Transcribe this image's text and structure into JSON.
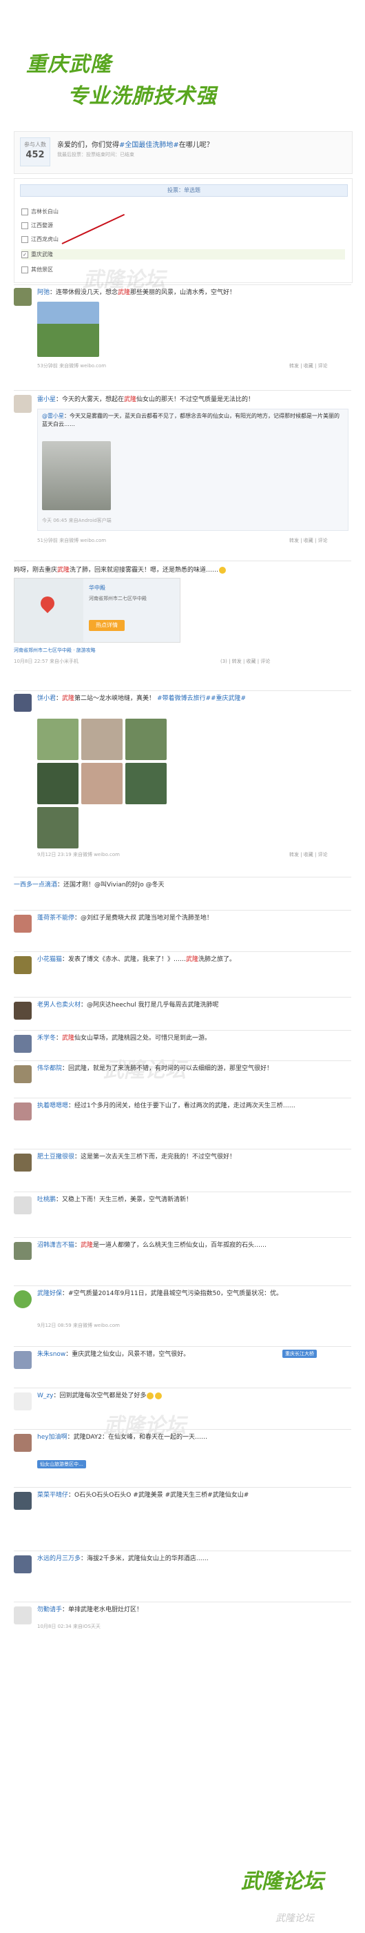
{
  "header": {
    "line1": "重庆武隆",
    "line2": "专业洗肺技术强"
  },
  "poll": {
    "count_label": "参与人数",
    "count": "452",
    "question_prefix": "亲爱的们，你们觉得",
    "question_link": "#全国最佳洗肺地#",
    "question_suffix": "在哪儿呢？",
    "meta": "我最后投票：投票结束时间：已结束",
    "bar_text": "投票：单选题",
    "options": [
      "吉林长白山",
      "江西婺源",
      "江西龙虎山",
      "重庆武隆",
      "其他景区"
    ],
    "selected_index": 3
  },
  "posts": [
    {
      "name": "阿弛",
      "text_a": "：连带休假没几天，想念",
      "kw1": "武隆",
      "text_b": "那些美丽的风景，山清水秀，空气好！",
      "meta": "53分钟前  来自微博 weibo.com",
      "acts": "转发 | 收藏 | 评论"
    },
    {
      "name": "雷小星",
      "text_a": "：今天的大雾天，想起在",
      "kw1": "武隆",
      "text_b": "仙女山的那天！不过空气质量是无法比的！",
      "quote_name": "@雷小星",
      "quote_text": "：今天又是雾霾的一天，蓝天白云都看不见了，都想念去年的仙女山，有阳光的地方，记得那时候都是一片美丽的蓝天白云……",
      "quote_meta": "今天 06:45  来自Android客户端",
      "meta": "51分钟前  来自微博 weibo.com",
      "acts": "转发 | 收藏 | 评论"
    },
    {
      "name": "",
      "text_a": "妈呀，刚去重庆",
      "kw1": "武隆",
      "text_b": "洗了肺，回来就迎接雾霾天！嗯，还是熟悉的味道……",
      "place_title": "华中殿",
      "place_addr": "河南省郑州市二七区华中殿",
      "hot_label": "热点详情",
      "loc": "河南省郑州市二七区华中殿 · 旅游攻略",
      "meta": "10月8日 22:57  来自小米手机",
      "acts": "(3) | 转发 | 收藏 | 评论"
    },
    {
      "name": "饼小君",
      "text_a": "：",
      "kw1": "武隆",
      "text_b": "第二站～龙水峡地缝，真美！",
      "tag": "#带着微博去旅行##重庆武隆#",
      "meta": "9月12日 23:19  来自微博 weibo.com",
      "acts": "转发 | 收藏 | 评论"
    },
    {
      "name": "一西多一点滴酒",
      "text_a": "：还国才刚！",
      "kw1": "",
      "text_b": "@叫Vivian的好Jo @冬天",
      "meta": "",
      "acts": ""
    },
    {
      "name": "蓬荷茶不能停",
      "text_a": "：",
      "kw1": "",
      "text_b": "@刘红子是费晓大叔 武隆当地对是个洗肺圣地！",
      "meta": "",
      "acts": ""
    },
    {
      "name": "小花猫猫",
      "text_a": "：发表了博文《赤水、武隆，我来了！》……",
      "kw1": "武隆",
      "text_b": "洗肺之旅了。",
      "meta": "",
      "acts": ""
    },
    {
      "name": "老男人也卖火材",
      "text_a": "：",
      "kw1": "",
      "text_b": "@阿庆达heechul 我打是几乎每周去武隆洗肺呢",
      "meta": "",
      "acts": ""
    },
    {
      "name": "禾学冬",
      "text_a": "：",
      "kw1": "武隆",
      "text_b": "仙女山草场，武隆桃园之处。可惜只是到此一游。",
      "meta": "",
      "acts": ""
    },
    {
      "name": "伟华都院",
      "text_a": "：",
      "kw1": "",
      "text_b": "回武隆，就是为了来洗肺不错，有时间的可以去细细的游，那里空气很好！",
      "meta": "",
      "acts": ""
    },
    {
      "name": "执着嗯嗯嗯",
      "text_a": "：",
      "kw1": "",
      "text_b": "经过1个多月的闭关，给住于要下山了，看过两次的武隆，走过两次天生三桥……",
      "meta": "",
      "acts": ""
    },
    {
      "name": "肥土豆撒很很",
      "text_a": "：",
      "kw1": "",
      "text_b": "这是第一次去天生三桥下而，走完我的！不过空气很好！",
      "meta": "",
      "acts": ""
    },
    {
      "name": "吐桃鹏",
      "text_a": "：",
      "kw1": "",
      "text_b": "又稳上下而！天生三桥，美景，空气清新清新！",
      "meta": "",
      "acts": ""
    },
    {
      "name": "沼韩潇吉不猫",
      "text_a": "：",
      "kw1": "武隆",
      "text_b": "是一道人都懒了，么么桃天生三桥仙女山，百年孤寂的石头……",
      "meta": "",
      "acts": ""
    },
    {
      "name": "武隆好保",
      "text_a": "：",
      "kw1": "",
      "text_b": "#空气质量2014年9月11日，武隆县城空气污染指数50，空气质量状况：优。",
      "meta": "9月12日 08:59  来自微博 weibo.com",
      "acts": ""
    },
    {
      "name": "朱朱snow",
      "text_a": "：重庆武隆之仙女山，风景不错，空气很好。",
      "kw1": "",
      "text_b": "",
      "badge": "重庆长江大桥",
      "meta": "",
      "acts": ""
    },
    {
      "name": "W_zy",
      "text_a": "：",
      "kw1": "",
      "text_b": "回到武隆每次空气都是处了好多",
      "meta": "",
      "acts": ""
    },
    {
      "name": "hey加油啊",
      "text_a": "：武隆DAY2：在仙女峰，和春天在一起的一天……",
      "kw1": "",
      "text_b": "",
      "badge": "仙女山旅游景区中…",
      "meta": "",
      "acts": ""
    },
    {
      "name": "菜菜平晴仔",
      "text_a": "：",
      "kw1": "",
      "text_b": "O石头O石头O石头O #武隆美景 #武隆天生三桥#武隆仙女山#",
      "meta": "",
      "acts": ""
    },
    {
      "name": "水远的月三万多",
      "text_a": "：",
      "kw1": "",
      "text_b": "海拔2千多米，武隆仙女山上的华邦酒店……",
      "meta": "",
      "acts": ""
    },
    {
      "name": "勿勤请手",
      "text_a": "：",
      "kw1": "",
      "text_b": "单排武隆老水电厨灶灯区！",
      "meta": "10月8日 02:34  来自iOS天天",
      "acts": ""
    }
  ],
  "watermark": "武隆论坛",
  "footer": {
    "logo": "武隆论坛",
    "wm": "武隆论坛"
  }
}
